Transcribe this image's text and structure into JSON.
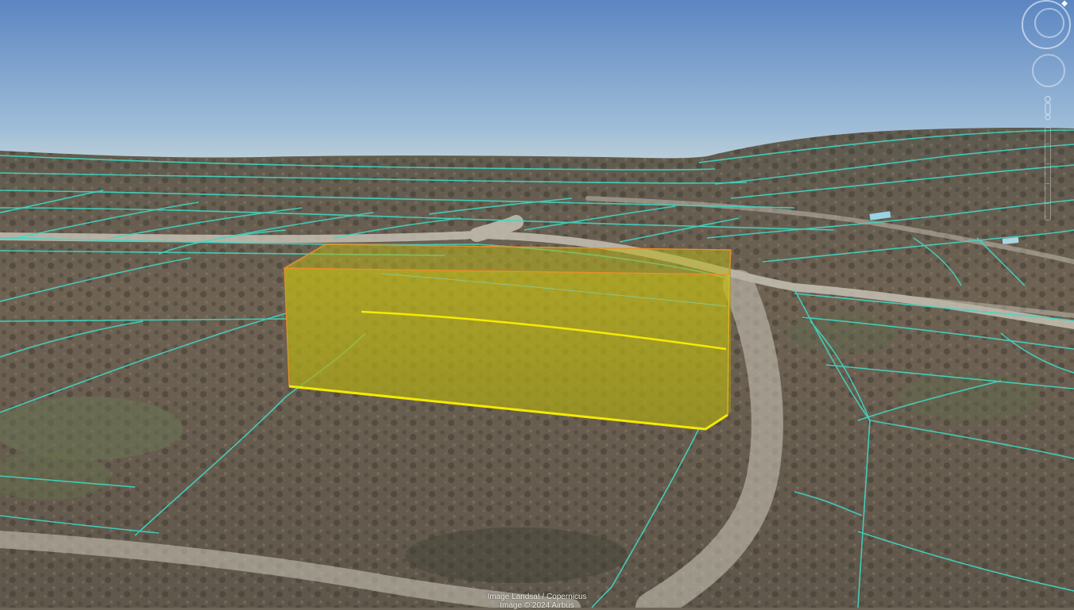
{
  "attribution": {
    "line1": "Image Landsat / Copernicus",
    "line2": "Image © 2024 Airbus"
  },
  "colors": {
    "sky_top": "#6189c4",
    "sky_bottom": "#b6ccd6",
    "ground": "#6b6256",
    "parcel_lines": "#3fd6c2",
    "volume_fill": "#c9c21a",
    "volume_edge": "#f2e600",
    "volume_outline": "#e88a1f",
    "road": "#c8c3b6"
  },
  "icons": {
    "compass": "compass-ring-icon",
    "north": "north-arrow-icon",
    "look": "look-joystick-icon",
    "street_view": "pegman-icon",
    "zoom": "zoom-slider-icon"
  }
}
